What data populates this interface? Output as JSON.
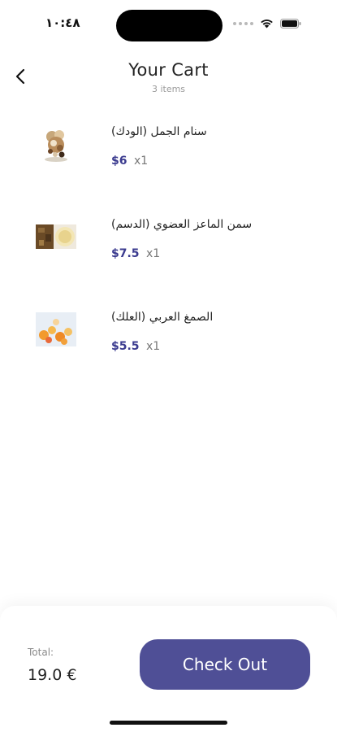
{
  "status_bar": {
    "time": "١٠:٤٨",
    "icons": [
      "cellular-signal-icon",
      "wifi-icon",
      "battery-icon"
    ]
  },
  "header": {
    "back_icon": "chevron-left-icon",
    "title": "Your Cart",
    "subtitle": "3 items"
  },
  "cart": {
    "items": [
      {
        "name": "سنام الجمل (الودك)",
        "price": "$6",
        "quantity": "x1",
        "image": "camel-hump-fat-image"
      },
      {
        "name": "سمن الماعز العضوي (الدسم)",
        "price": "$7.5",
        "quantity": "x1",
        "image": "goat-ghee-image"
      },
      {
        "name": "الصمغ العربي (العلك)",
        "price": "$5.5",
        "quantity": "x1",
        "image": "arabic-gum-image"
      }
    ]
  },
  "footer": {
    "total_label": "Total:",
    "total_value": "19.0 €",
    "checkout_label": "Check Out",
    "checkout_color": "#4f4f96"
  },
  "colors": {
    "price_accent": "#3b3b8f",
    "background": "#ffffff"
  }
}
